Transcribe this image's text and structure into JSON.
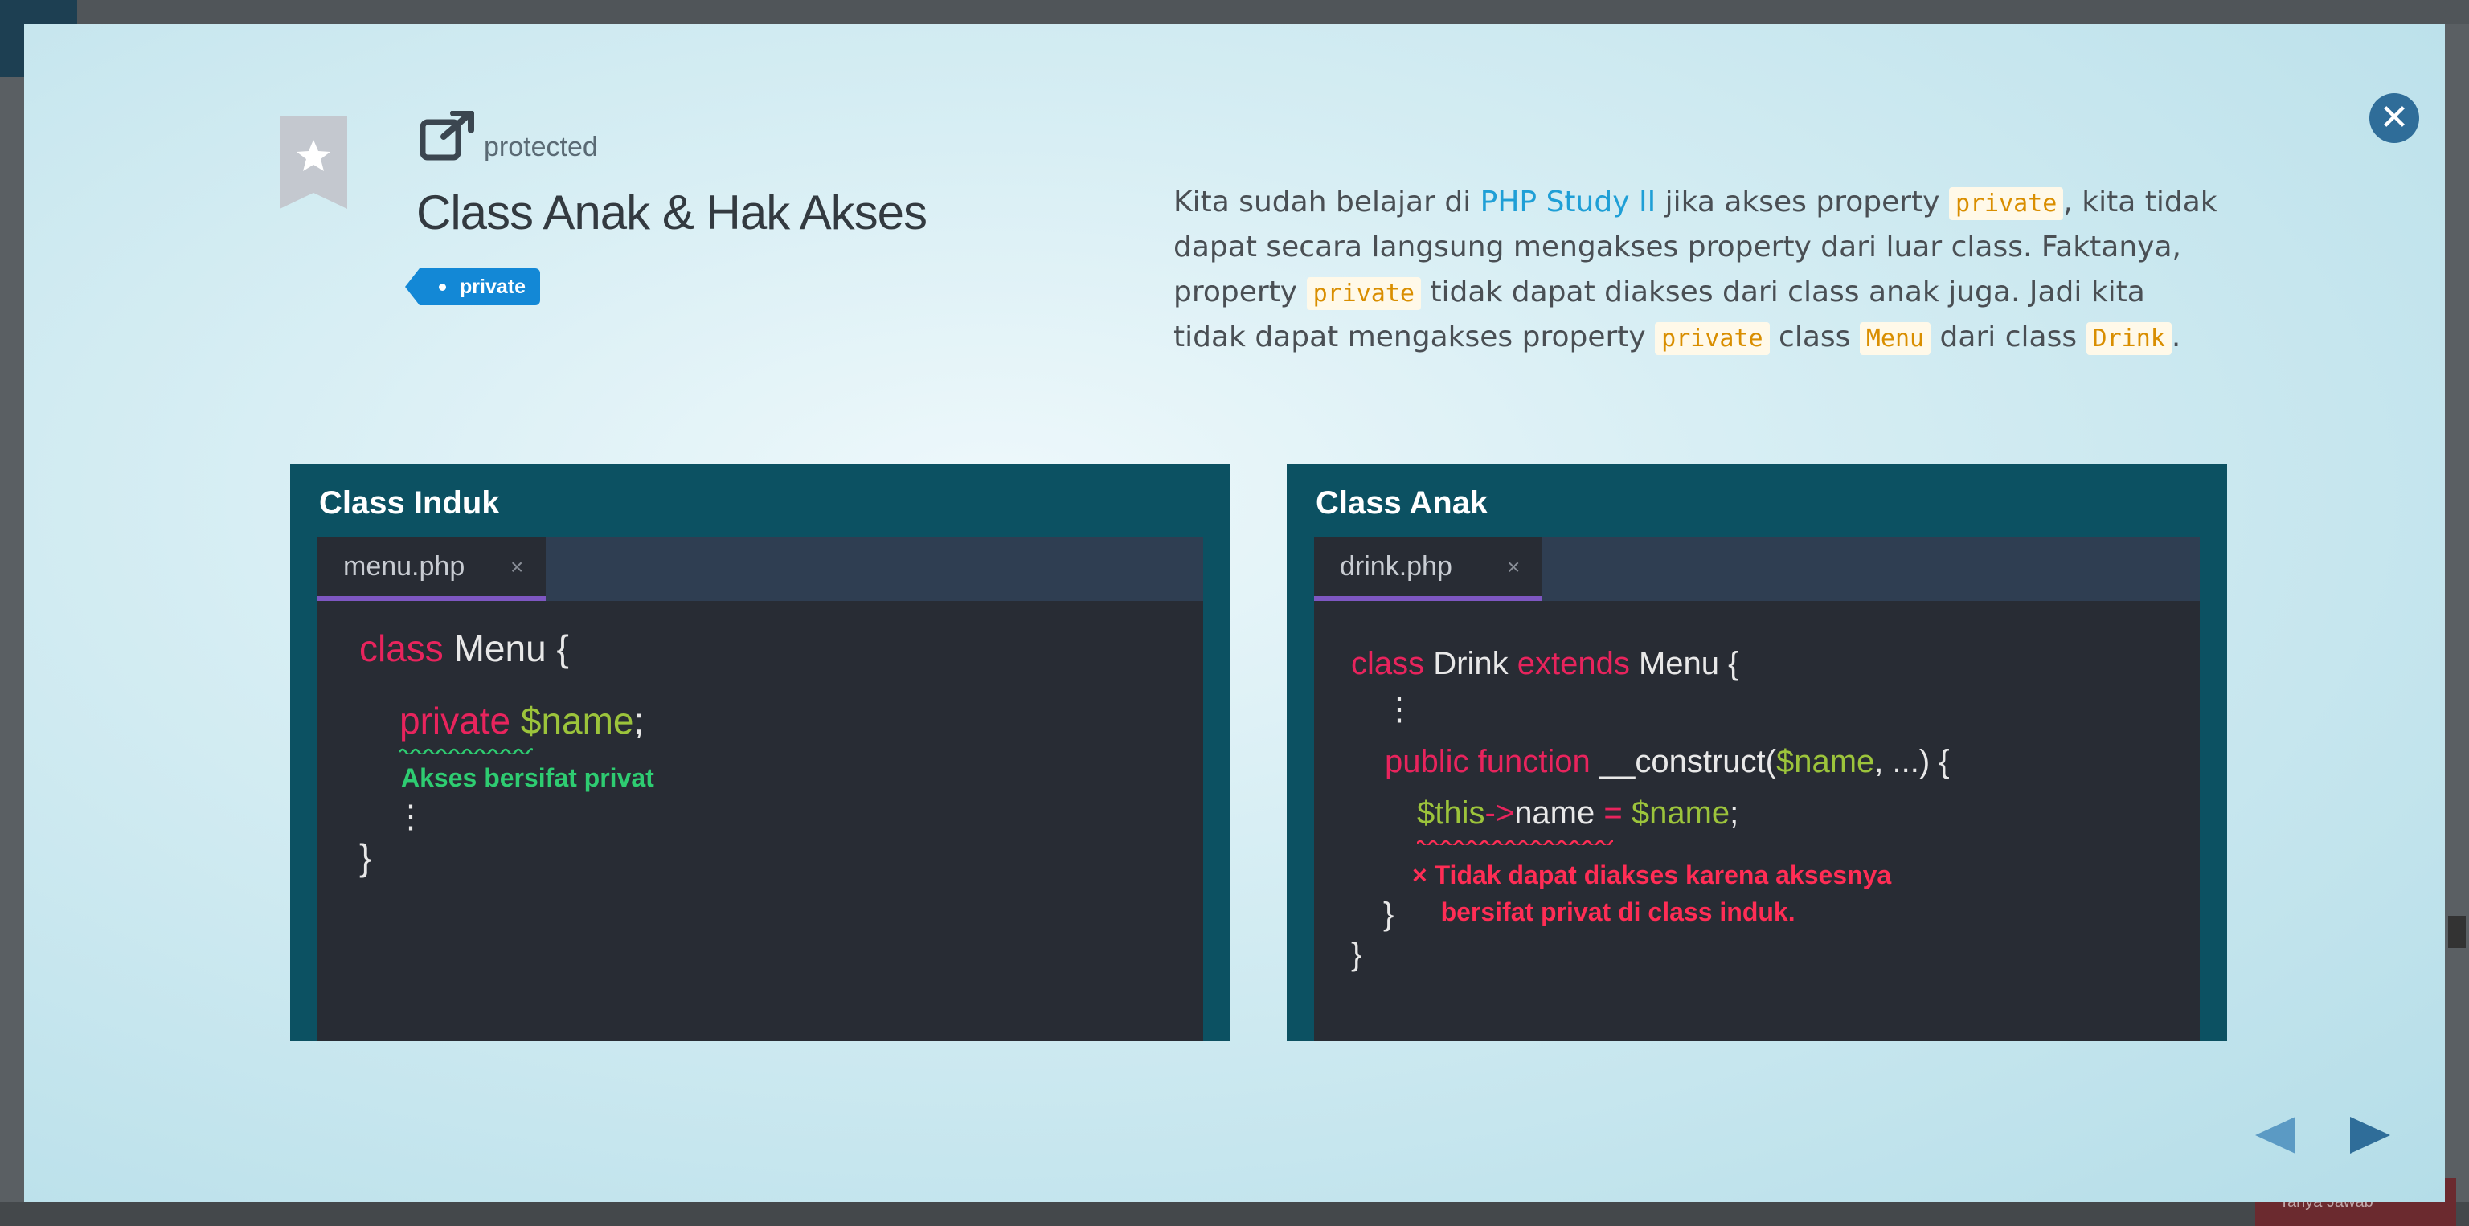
{
  "background": {
    "help_label": "Tanya Jawab"
  },
  "modal": {
    "subtitle": "protected",
    "title": "Class Anak & Hak Akses",
    "tag": "private",
    "desc": {
      "p1": "Kita sudah belajar di ",
      "link": "PHP Study II",
      "p2": " jika akses property ",
      "c1": "private",
      "p3": ", kita tidak dapat secara langsung mengakses property dari luar class. Faktanya, property ",
      "c2": "private",
      "p4": " tidak dapat diakses dari class anak juga. Jadi kita tidak dapat mengakses property ",
      "c3": "private",
      "p5": " class ",
      "c4": "Menu",
      "p6": " dari class ",
      "c5": "Drink",
      "p7": "."
    },
    "left_panel": {
      "title": "Class Induk",
      "tab": "menu.php",
      "tab_close": "×",
      "line1_kw": "class",
      "line1_rest": " Menu {",
      "line2_kw": "private",
      "line2_var": "$name",
      "line2_end": ";",
      "note": "Akses bersifat privat",
      "ellipsis": "⋮",
      "close_brace": "}"
    },
    "right_panel": {
      "title": "Class Anak",
      "tab": "drink.php",
      "tab_close": "×",
      "line1_kw1": "class",
      "line1_name": " Drink ",
      "line1_kw2": "extends",
      "line1_rest": " Menu {",
      "ellipsis": "⋮",
      "line3_kw": "public function",
      "line3_fn": " __construct(",
      "line3_var": "$name",
      "line3_end": ", ...) {",
      "line4_var": "$this",
      "line4_arrow": "->",
      "line4_prop": "name ",
      "line4_eq": "=",
      "line4_val": " $name",
      "line4_end": ";",
      "note": "× Tidak dapat diakses karena aksesnya\n    bersifat privat di class induk.",
      "inner_brace": "}",
      "close_brace": "}"
    }
  },
  "colors": {
    "panel_bg": "#0c5162",
    "editor_bg": "#282c34",
    "keyword": "#e8245d",
    "variable": "#9cc43b",
    "tag_bg": "#1388d6",
    "close_btn": "#2f6d99"
  },
  "icons": [
    "bookmark-icon",
    "external-link-icon",
    "close-icon",
    "prev-arrow-icon",
    "next-arrow-icon"
  ]
}
